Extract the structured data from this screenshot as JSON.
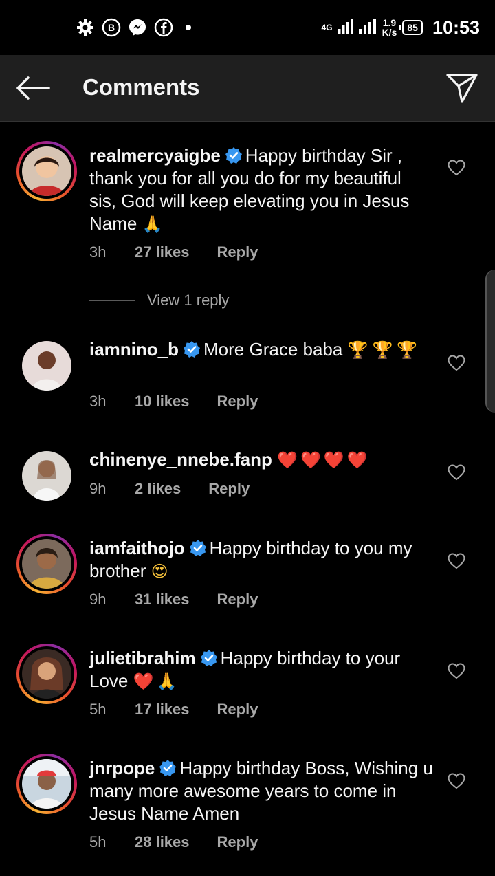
{
  "status_bar": {
    "network_type": "4G",
    "speed_value": "1.9",
    "speed_unit": "K/s",
    "battery": "85",
    "time": "10:53",
    "notification_icons": [
      "settings-icon",
      "business-icon",
      "messenger-icon",
      "facebook-icon",
      "dot-icon"
    ]
  },
  "header": {
    "title": "Comments",
    "back_icon": "arrow-left-icon",
    "share_icon": "send-icon"
  },
  "comments": [
    {
      "username": "realmercyaigbe",
      "verified": true,
      "text": "Happy birthday Sir , thank you for all you do for my beautiful sis, God will keep elevating you in Jesus Name",
      "emojis": "🙏",
      "time": "3h",
      "likes": "27 likes",
      "reply": "Reply",
      "view_replies": "View 1 reply",
      "has_story_ring": true,
      "avatar_colors": [
        "#c72b2b",
        "#f1c8a8"
      ]
    },
    {
      "username": "iamnino_b",
      "verified": true,
      "text": "More Grace baba",
      "emojis": "🏆🏆🏆",
      "time": "3h",
      "likes": "10 likes",
      "reply": "Reply",
      "has_story_ring": false,
      "avatar_colors": [
        "#e9d7d5",
        "#6b3d2a"
      ]
    },
    {
      "username": "chinenye_nnebe.fanp",
      "verified": false,
      "text": "",
      "emojis": "❤️❤️❤️❤️",
      "time": "9h",
      "likes": "2 likes",
      "reply": "Reply",
      "has_story_ring": false,
      "avatar_colors": [
        "#d8d4cf",
        "#b88a6c"
      ]
    },
    {
      "username": "iamfaithojo",
      "verified": true,
      "text": "Happy birthday to you my brother",
      "emojis": "😍",
      "time": "9h",
      "likes": "31 likes",
      "reply": "Reply",
      "has_story_ring": true,
      "avatar_colors": [
        "#d8a940",
        "#4a3322"
      ]
    },
    {
      "username": "julietibrahim",
      "verified": true,
      "text": "Happy birthday to your Love",
      "emojis": "❤️🙏",
      "time": "5h",
      "likes": "17 likes",
      "reply": "Reply",
      "has_story_ring": true,
      "avatar_colors": [
        "#6b3b28",
        "#d9a37a"
      ]
    },
    {
      "username": "jnrpope",
      "verified": true,
      "text": "Happy birthday Boss, Wishing u many more awesome years to come in Jesus Name Amen",
      "emojis": "",
      "time": "5h",
      "likes": "28 likes",
      "reply": "Reply",
      "has_story_ring": true,
      "avatar_colors": [
        "#dfe6ec",
        "#8a6147"
      ]
    }
  ],
  "colors": {
    "background": "#000000",
    "header_bg": "#1f1f1f",
    "text": "#f5f5f5",
    "meta_text": "#a8a8a8",
    "verified_blue": "#3897f0"
  }
}
